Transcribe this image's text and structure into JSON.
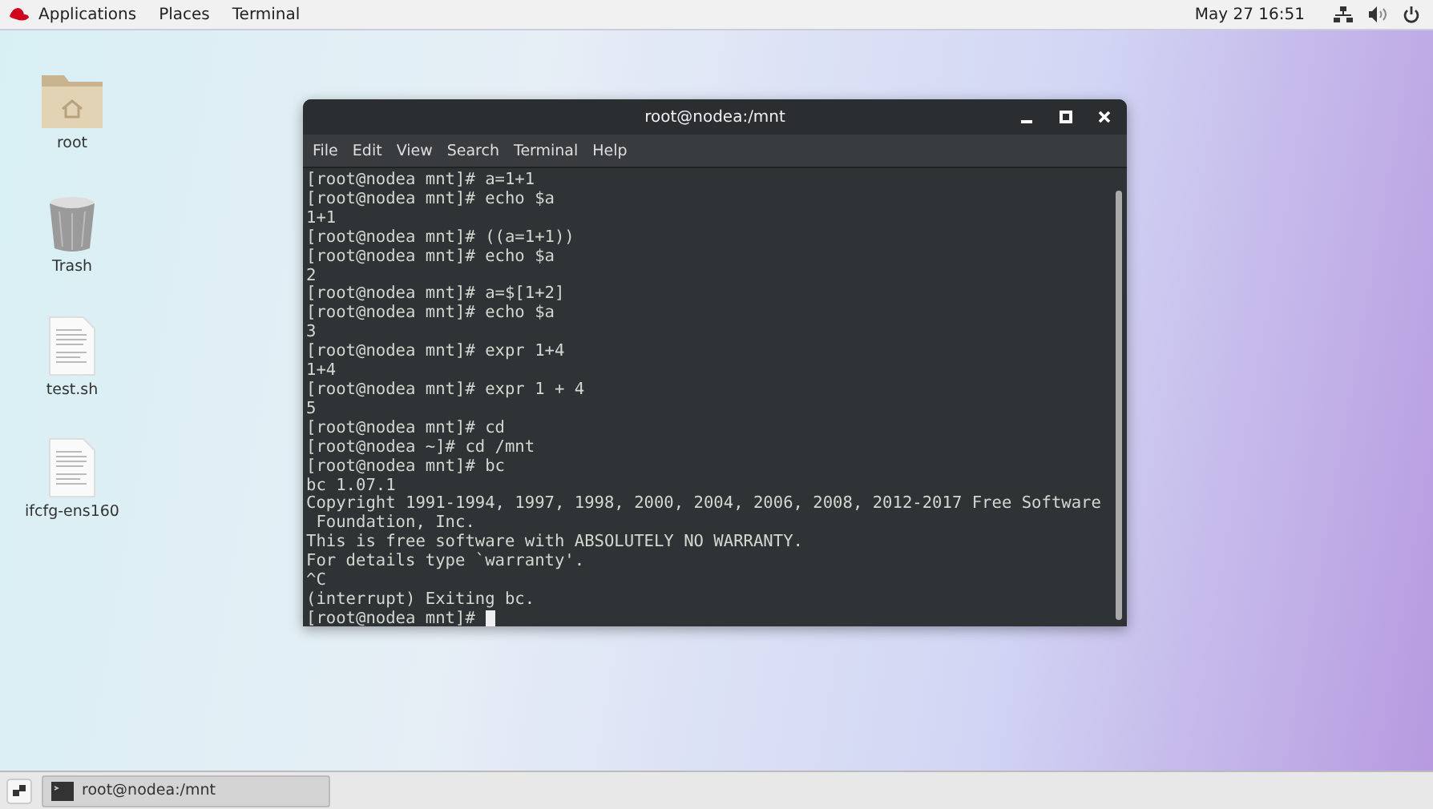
{
  "top_bar": {
    "menus": [
      "Applications",
      "Places",
      "Terminal"
    ],
    "clock": "May 27  16:51"
  },
  "desktop_icons": [
    {
      "kind": "folder",
      "label": "root"
    },
    {
      "kind": "trash",
      "label": "Trash"
    },
    {
      "kind": "file",
      "label": "test.sh"
    },
    {
      "kind": "file",
      "label": "ifcfg-ens160"
    }
  ],
  "terminal": {
    "title": "root@nodea:/mnt",
    "menu": [
      "File",
      "Edit",
      "View",
      "Search",
      "Terminal",
      "Help"
    ],
    "lines": [
      "[root@nodea mnt]# a=1+1",
      "[root@nodea mnt]# echo $a",
      "1+1",
      "[root@nodea mnt]# ((a=1+1))",
      "[root@nodea mnt]# echo $a",
      "2",
      "[root@nodea mnt]# a=$[1+2]",
      "[root@nodea mnt]# echo $a",
      "3",
      "[root@nodea mnt]# expr 1+4",
      "1+4",
      "[root@nodea mnt]# expr 1 + 4",
      "5",
      "[root@nodea mnt]# cd",
      "[root@nodea ~]# cd /mnt",
      "[root@nodea mnt]# bc",
      "bc 1.07.1",
      "Copyright 1991-1994, 1997, 1998, 2000, 2004, 2006, 2008, 2012-2017 Free Software",
      " Foundation, Inc.",
      "This is free software with ABSOLUTELY NO WARRANTY.",
      "For details type `warranty'.",
      "^C",
      "(interrupt) Exiting bc."
    ],
    "prompt": "[root@nodea mnt]# "
  },
  "taskbar": {
    "tasks": [
      {
        "label": "root@nodea:/mnt",
        "selected": true
      }
    ]
  }
}
